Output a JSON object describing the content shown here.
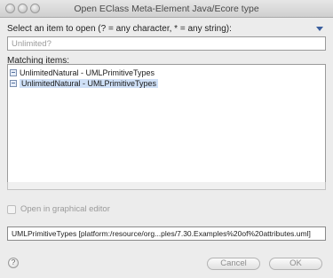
{
  "window": {
    "title": "Open EClass Meta-Element Java/Ecore type"
  },
  "dialog": {
    "prompt": "Select an item to open (? = any character, * = any string):",
    "search": {
      "value": "",
      "placeholder": "Unlimited?"
    },
    "matching_label": "Matching items:",
    "items": [
      {
        "label": "UnlimitedNatural - UMLPrimitiveTypes",
        "selected": false
      },
      {
        "label": "UnlimitedNatural - UMLPrimitiveTypes",
        "selected": true
      }
    ],
    "checkbox_label": "Open in graphical editor",
    "details": "UMLPrimitiveTypes [platform:/resource/org...ples/7.30.Examples%20of%20attributes.uml]",
    "buttons": {
      "help": "?",
      "cancel": "Cancel",
      "ok": "OK"
    }
  },
  "icons": {
    "window_controls": "traffic-light-buttons",
    "menu": "chevron-down-icon",
    "item_icon": "type-icon",
    "help_icon": "help-icon"
  },
  "colors": {
    "selection": "#cfe0f7",
    "menu_arrow": "#3b5f9e"
  }
}
